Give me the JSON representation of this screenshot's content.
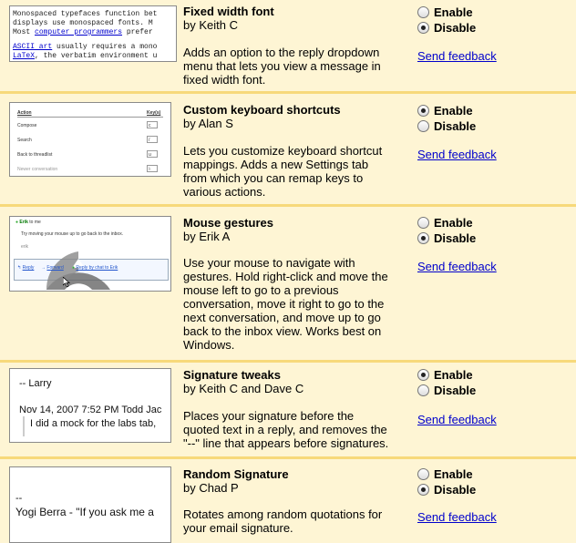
{
  "labs": [
    {
      "title": "Fixed width font",
      "author": "by Keith C",
      "description": "Adds an option to the reply dropdown menu that lets you view a message in fixed width font.",
      "selected": "disable",
      "thumb": {
        "lines": [
          "Monospaced typefaces function bet",
          "displays use monospaced fonts. M"
        ],
        "line3_pre": "Most ",
        "line3_link": "computer programmers",
        "line3_post": " prefer",
        "line4_link": "ASCII art",
        "line4_post": " usually requires a mono",
        "line5_link": "LaTeX",
        "line5_post": ", the verbatim environment u"
      }
    },
    {
      "title": "Custom keyboard shortcuts",
      "author": "by Alan S",
      "description": "Lets you customize keyboard shortcut mappings. Adds a new Settings tab from which you can remap keys to various actions.",
      "selected": "enable",
      "thumb": {
        "header_action": "Action",
        "header_keys": "Key(s)",
        "rows": [
          {
            "action": "Compose",
            "key": "c"
          },
          {
            "action": "Search",
            "key": "/"
          },
          {
            "action": "Back to threadlist",
            "key": "u"
          },
          {
            "action": "Newer conversation",
            "key": "k"
          }
        ]
      }
    },
    {
      "title": "Mouse gestures",
      "author": "by Erik A",
      "description": "Use your mouse to navigate with gestures. Hold right-click and move the mouse left to go to a previous conversation, move it right to go to the next conversation, and move up to go back to the inbox view. Works best on Windows.",
      "selected": "disable",
      "thumb": {
        "from": "Erik",
        "to": "to me",
        "body": "Try moving your mouse up to go back to the inbox.",
        "sig": "erik",
        "reply": "Reply",
        "forward": "Forward",
        "chat": "Reply by chat to Erik"
      }
    },
    {
      "title": "Signature tweaks",
      "author": "by Keith C and Dave C",
      "description": "Places your signature before the quoted text in a reply, and removes the \"--\" line that appears before signatures.",
      "selected": "enable",
      "thumb": {
        "sig": "-- Larry",
        "date": "Nov 14, 2007 7:52 PM Todd Jac",
        "quote": "I did a mock for the labs tab,"
      }
    },
    {
      "title": "Random Signature",
      "author": "by Chad P",
      "description": "Rotates among random quotations for your email signature.",
      "selected": "disable",
      "thumb": {
        "dashes": "--",
        "quote": "Yogi Berra  - \"If you ask me a"
      }
    }
  ],
  "enable_label": "Enable",
  "disable_label": "Disable",
  "feedback_label": "Send feedback"
}
